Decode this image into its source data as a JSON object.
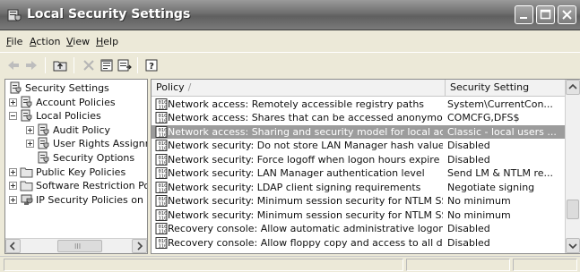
{
  "window": {
    "title": "Local Security Settings",
    "icon": "security-settings-icon"
  },
  "titlebar_buttons": [
    "minimize-icon",
    "maximize-icon",
    "close-icon"
  ],
  "menu": {
    "file": {
      "u": "F",
      "rest": "ile"
    },
    "action": {
      "u": "A",
      "rest": "ction"
    },
    "view": {
      "u": "V",
      "rest": "iew"
    },
    "help": {
      "u": "H",
      "rest": "elp"
    }
  },
  "toolbar": [
    "back-arrow-icon",
    "forward-arrow-icon",
    "up-folder-icon",
    "delete-icon",
    "properties-icon",
    "export-list-icon",
    "help-icon"
  ],
  "tree": {
    "items": [
      {
        "label": "Security Settings",
        "level": 0,
        "expander": "none"
      },
      {
        "label": "Account Policies",
        "level": 1,
        "expander": "plus"
      },
      {
        "label": "Local Policies",
        "level": 1,
        "expander": "minus"
      },
      {
        "label": "Audit Policy",
        "level": 2,
        "expander": "plus"
      },
      {
        "label": "User Rights Assignmen",
        "level": 2,
        "expander": "plus"
      },
      {
        "label": "Security Options",
        "level": 2,
        "expander": "none"
      },
      {
        "label": "Public Key Policies",
        "level": 1,
        "expander": "plus"
      },
      {
        "label": "Software Restriction Policie",
        "level": 1,
        "expander": "plus"
      },
      {
        "label": "IP Security Policies on Loca",
        "level": 1,
        "expander": "plus"
      }
    ],
    "scroll_glyph": "III"
  },
  "list": {
    "columns": {
      "policy": "Policy",
      "sort_indicator": "/",
      "setting": "Security Setting"
    },
    "rows": [
      {
        "policy": "Network access: Remotely accessible registry paths",
        "setting": "System\\CurrentCon...",
        "selected": false
      },
      {
        "policy": "Network access: Shares that can be accessed anonymously",
        "setting": "COMCFG,DFS$",
        "selected": false
      },
      {
        "policy": "Network access: Sharing and security model for local accounts",
        "setting": "Classic - local users ...",
        "selected": true
      },
      {
        "policy": "Network security: Do not store LAN Manager hash value on next pa...",
        "setting": "Disabled",
        "selected": false
      },
      {
        "policy": "Network security: Force logoff when logon hours expire",
        "setting": "Disabled",
        "selected": false
      },
      {
        "policy": "Network security: LAN Manager authentication level",
        "setting": "Send LM & NTLM re...",
        "selected": false
      },
      {
        "policy": "Network security: LDAP client signing requirements",
        "setting": "Negotiate signing",
        "selected": false
      },
      {
        "policy": "Network security: Minimum session security for NTLM SSP based (in...",
        "setting": "No minimum",
        "selected": false
      },
      {
        "policy": "Network security: Minimum session security for NTLM SSP based (in...",
        "setting": "No minimum",
        "selected": false
      },
      {
        "policy": "Recovery console: Allow automatic administrative logon",
        "setting": "Disabled",
        "selected": false
      },
      {
        "policy": "Recovery console: Allow floppy copy and access to all drives and all...",
        "setting": "Disabled",
        "selected": false
      }
    ]
  },
  "colors": {
    "titlebar": "#6e6e6e",
    "selected_row": "#9c9c9c",
    "chrome": "#ece9d8"
  }
}
